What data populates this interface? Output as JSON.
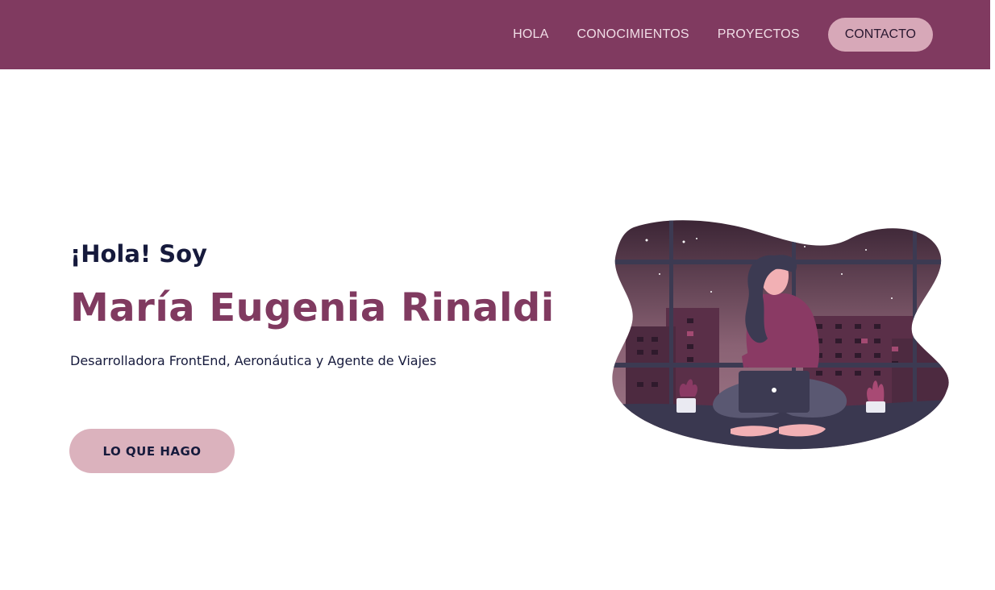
{
  "nav": {
    "items": [
      {
        "label": "HOLA"
      },
      {
        "label": "CONOCIMIENTOS"
      },
      {
        "label": "PROYECTOS"
      }
    ],
    "cta_label": "CONTACTO"
  },
  "hero": {
    "greeting": "¡Hola! Soy",
    "name": "María Eugenia Rinaldi",
    "subtitle": "Desarrolladora FrontEnd, Aeronáutica y Agente de Viajes",
    "button_label": "LO QUE HAGO"
  },
  "colors": {
    "brand": "#803a60",
    "accent_pink": "#dbb2bd",
    "text_dark": "#161a3c"
  },
  "illustration": {
    "icon": "woman-with-laptop-night-illustration"
  }
}
